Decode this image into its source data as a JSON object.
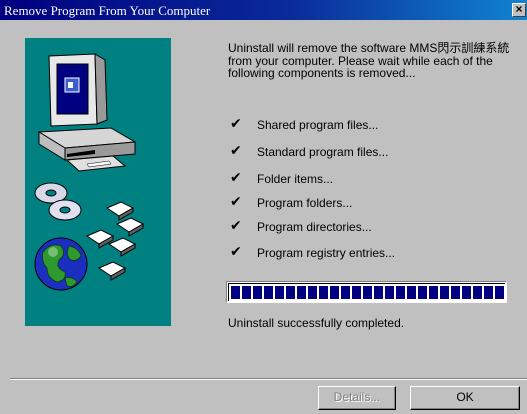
{
  "window": {
    "title": "Remove Program From Your Computer",
    "close_glyph": "×"
  },
  "message": "Uninstall will remove the software MMS閃示訓練系統 from your computer. Please wait while each of the following components is removed...",
  "checklist": {
    "check_glyph": "✔",
    "items": [
      {
        "label": "Shared program files..."
      },
      {
        "label": "Standard program files..."
      },
      {
        "label": "Folder items..."
      },
      {
        "label": "Program folders..."
      },
      {
        "label": "Program directories..."
      },
      {
        "label": "Program registry entries..."
      }
    ]
  },
  "progress": {
    "value_percent": 100,
    "fill_color": "#000080"
  },
  "status_text": "Uninstall successfully completed.",
  "buttons": {
    "details_label": "Details...",
    "ok_label": "OK"
  },
  "colors": {
    "title_gradient_start": "#000080",
    "art_background": "#008080",
    "dialog_face": "#c0c0c0"
  },
  "icons": {
    "art": [
      "computer-icon",
      "cd-disc-icon",
      "floppy-disk-icon",
      "globe-icon"
    ]
  }
}
